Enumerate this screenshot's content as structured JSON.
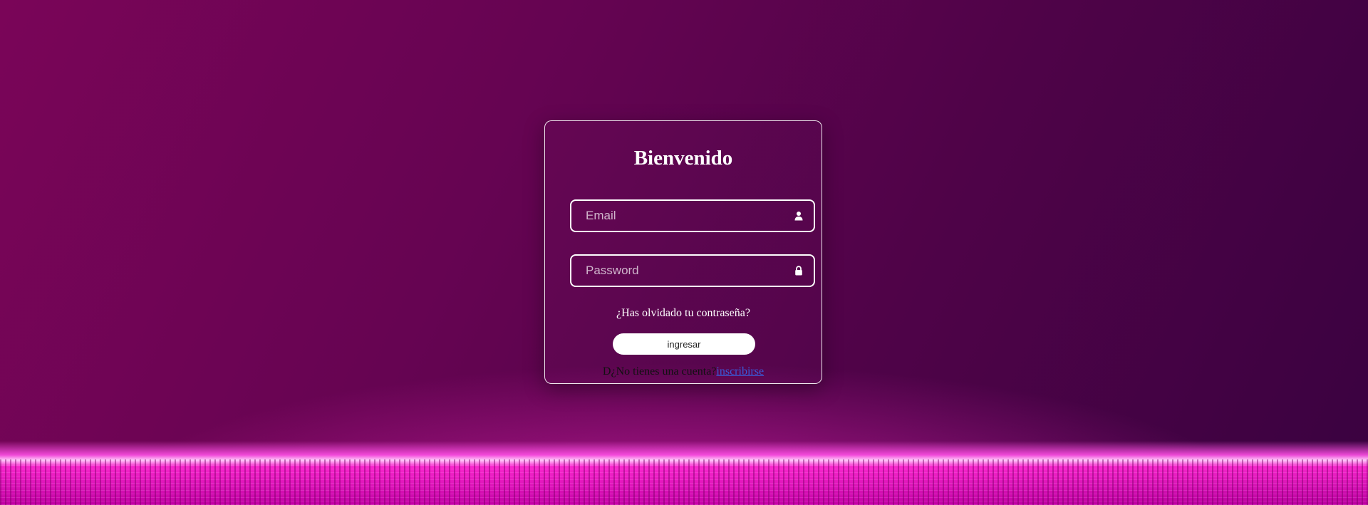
{
  "login": {
    "title": "Bienvenido",
    "email_placeholder": "Email",
    "email_icon": "user-icon",
    "password_placeholder": "Password",
    "password_icon": "lock-icon",
    "forgot_password": "¿Has olvidado tu contraseña?",
    "submit_label": "ingresar",
    "signup_prompt": "D¿No tienes una cuenta?",
    "signup_link": "inscribirse"
  },
  "colors": {
    "background_primary": "#6a0453",
    "background_dark": "#3a0240",
    "glow": "#ff28c8",
    "card_border": "#ffffff",
    "link": "#3a5bd9"
  }
}
